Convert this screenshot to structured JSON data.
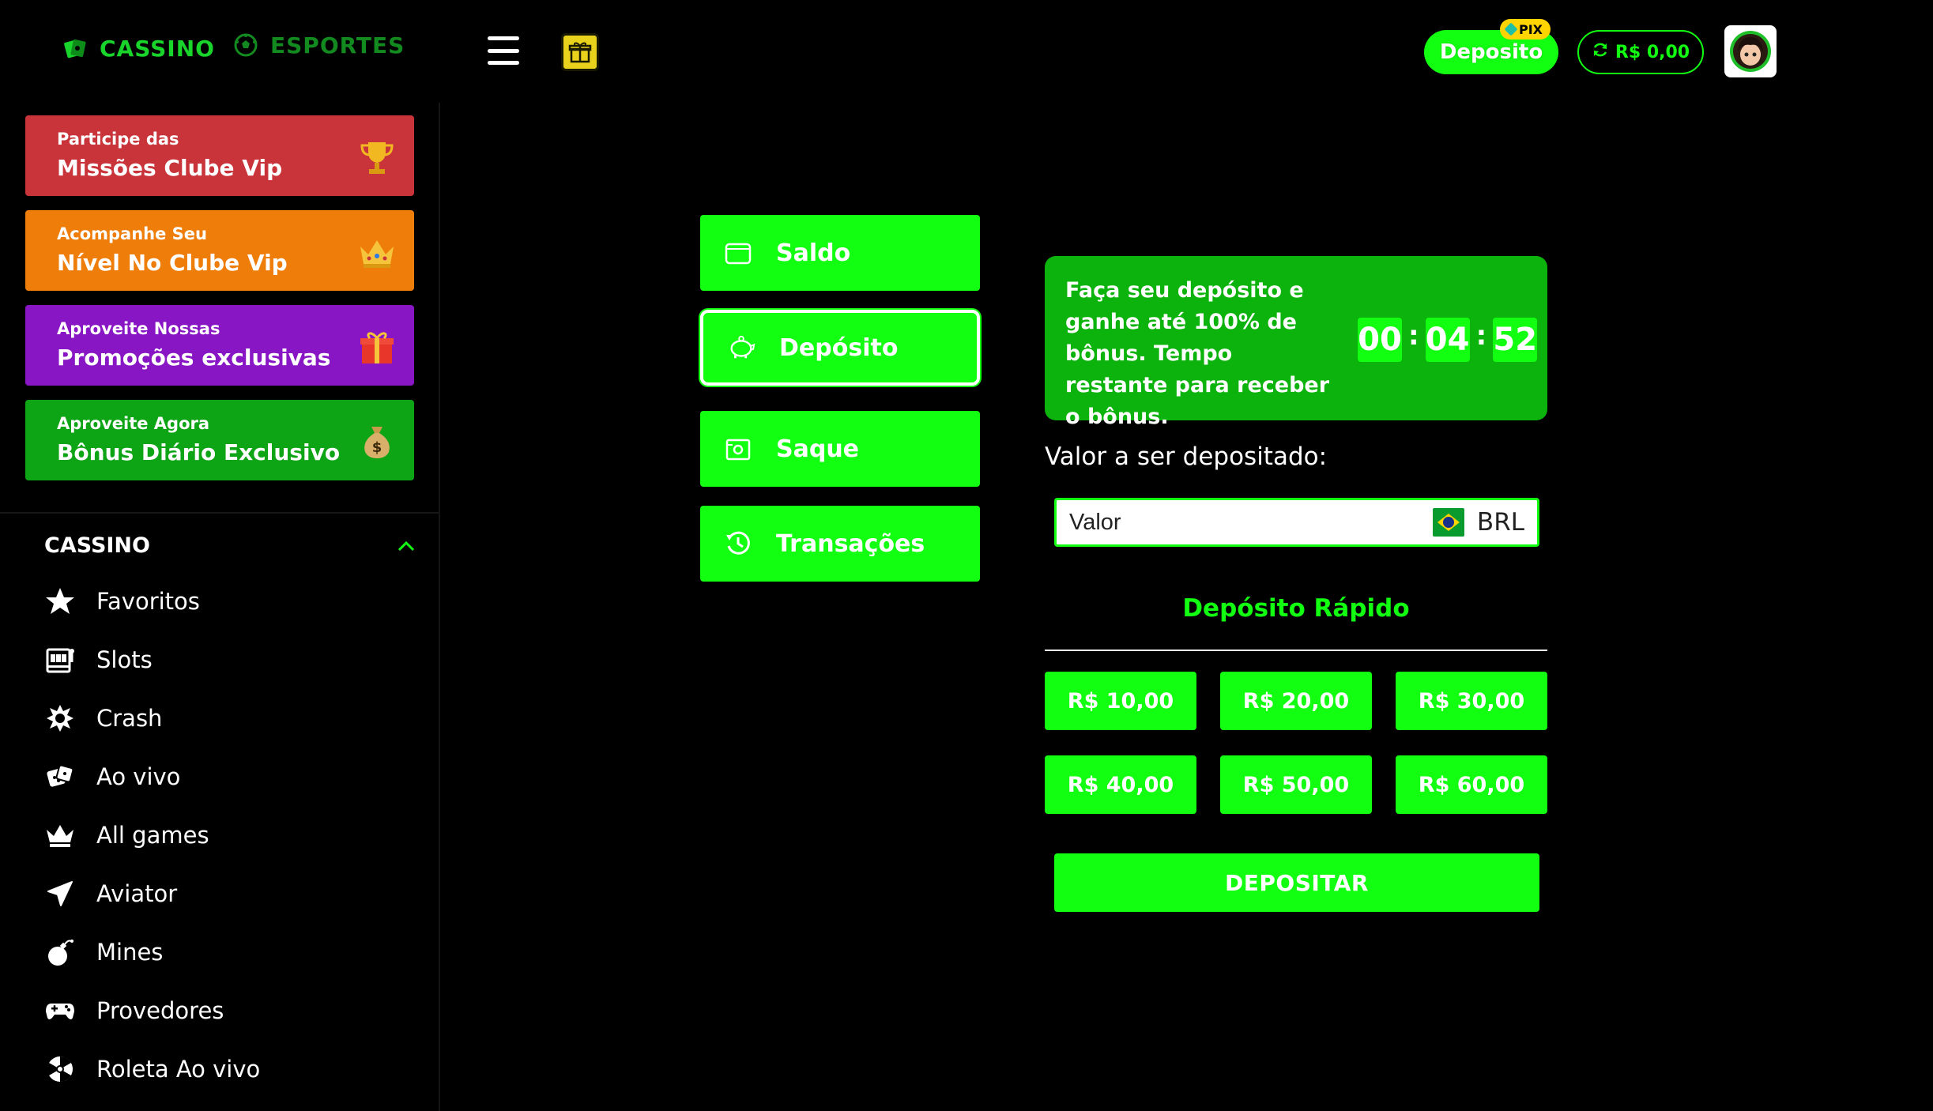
{
  "header": {
    "cassino_label": "CASSINO",
    "esportes_label": "ESPORTES",
    "deposit_label": "Deposito",
    "pix_badge": "PIX",
    "balance": "R$ 0,00"
  },
  "sidebar": {
    "promos": [
      {
        "small": "Participe das",
        "big": "Missões Clube Vip",
        "color": "#c8343a",
        "icon": "trophy-icon"
      },
      {
        "small": "Acompanhe Seu",
        "big": "Nível No Clube Vip",
        "color": "#ef7d0a",
        "icon": "crown-icon"
      },
      {
        "small": "Aproveite Nossas",
        "big": "Promoções exclusivas",
        "color": "#8816c4",
        "icon": "gift-box-icon"
      },
      {
        "small": "Aproveite Agora",
        "big": "Bônus Diário Exclusivo",
        "color": "#0da415",
        "icon": "money-bag-icon"
      }
    ],
    "section_title": "CASSINO",
    "items": [
      {
        "label": "Favoritos",
        "icon": "star-icon"
      },
      {
        "label": "Slots",
        "icon": "slot-machine-icon"
      },
      {
        "label": "Crash",
        "icon": "crash-icon"
      },
      {
        "label": "Ao vivo",
        "icon": "dice-icon"
      },
      {
        "label": "All games",
        "icon": "crown-icon"
      },
      {
        "label": "Aviator",
        "icon": "airplane-icon"
      },
      {
        "label": "Mines",
        "icon": "bomb-icon"
      },
      {
        "label": "Provedores",
        "icon": "gamepad-icon"
      },
      {
        "label": "Roleta Ao vivo",
        "icon": "roulette-icon"
      }
    ]
  },
  "wallet_menu": [
    {
      "label": "Saldo",
      "icon": "wallet-icon"
    },
    {
      "label": "Depósito",
      "icon": "piggy-bank-icon",
      "active": true
    },
    {
      "label": "Saque",
      "icon": "cash-icon"
    },
    {
      "label": "Transações",
      "icon": "history-icon"
    }
  ],
  "deposit": {
    "bonus_text": "Faça seu depósito e ganhe até 100% de bônus. Tempo restante para receber o bônus.",
    "timer": {
      "hours": "00",
      "minutes": "04",
      "seconds": "52"
    },
    "amount_label": "Valor a ser depositado:",
    "amount_placeholder": "Valor",
    "currency": "BRL",
    "quick_title": "Depósito Rápido",
    "quick_amounts": [
      "R$ 10,00",
      "R$ 20,00",
      "R$ 30,00",
      "R$ 40,00",
      "R$ 50,00",
      "R$ 60,00"
    ],
    "submit_label": "DEPOSITAR"
  },
  "colors": {
    "accent": "#12ff12",
    "bonus_bg": "#0db30d",
    "background": "#000000"
  }
}
